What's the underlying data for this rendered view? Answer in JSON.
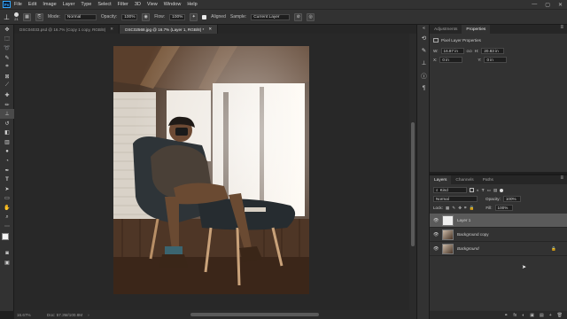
{
  "app": {
    "logo": "Ps"
  },
  "menu": [
    "File",
    "Edit",
    "Image",
    "Layer",
    "Type",
    "Select",
    "Filter",
    "3D",
    "View",
    "Window",
    "Help"
  ],
  "window_controls": [
    "—",
    "▢",
    "✕"
  ],
  "options_bar": {
    "brush_size": "21",
    "mode_label": "Mode:",
    "mode_value": "Normal",
    "opacity_label": "Opacity:",
    "opacity_value": "100%",
    "flow_label": "Flow:",
    "flow_value": "100%",
    "aligned_label": "Aligned",
    "sample_label": "Sample:",
    "sample_value": "Current Layer"
  },
  "tabs": [
    {
      "label": "DSC04033.psd @ 16.7% (Copy 1 copy, RGB/8)",
      "close": "✕"
    },
    {
      "label": "DSC02568.jpg @ 16.7% (Layer 1, RGB/8) *",
      "close": "✕"
    }
  ],
  "status": {
    "zoom": "16.67%",
    "doc": "Doc: 57.3M/100.8M",
    "arrow": "›"
  },
  "properties": {
    "tabs": [
      "Adjustments",
      "Properties"
    ],
    "section": "Pixel Layer Properties",
    "w_label": "W:",
    "w_value": "16.87 in",
    "h_label": "H:",
    "h_value": "20.83 in",
    "x_label": "X:",
    "x_value": "0 in",
    "y_label": "Y:",
    "y_value": "0 in",
    "link_label": "GO"
  },
  "layers_panel": {
    "tabs": [
      "Layers",
      "Channels",
      "Paths"
    ],
    "kind_label": "Kind",
    "blend_mode": "Normal",
    "opacity_label": "Opacity:",
    "opacity_value": "100%",
    "lock_label": "Lock:",
    "fill_label": "Fill:",
    "fill_value": "100%",
    "layers": [
      {
        "name": "Layer 1"
      },
      {
        "name": "Background copy"
      },
      {
        "name": "Background"
      }
    ],
    "bottom_icons": [
      "fx",
      "◐",
      "▣",
      "▤",
      "+",
      "🗑"
    ]
  },
  "colors": {
    "accent": "#31a8ff",
    "panel": "#323232",
    "canvas": "#282828"
  }
}
